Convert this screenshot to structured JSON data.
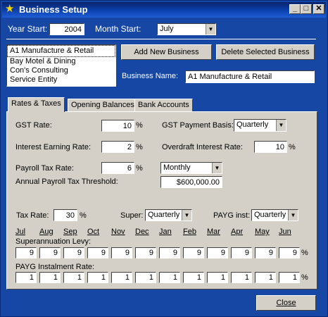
{
  "window": {
    "title": "Business Setup"
  },
  "header": {
    "year_start_label": "Year Start:",
    "year_start_value": "2004",
    "month_start_label": "Month Start:",
    "month_start_value": "July"
  },
  "businesses": {
    "items": [
      "A1 Manufacture & Retail",
      "Bay Motel & Dining",
      "Con's Consulting",
      "Service Entity"
    ],
    "selected_index": 0,
    "add_button": "Add New Business",
    "delete_button": "Delete Selected Business",
    "name_label": "Business Name:",
    "name_value": "A1 Manufacture & Retail"
  },
  "tabs": [
    "Rates & Taxes",
    "Opening Balances",
    "Bank Accounts"
  ],
  "rates": {
    "gst_rate_label": "GST Rate:",
    "gst_rate_value": "10",
    "gst_basis_label": "GST Payment Basis:",
    "gst_basis_value": "Quarterly",
    "interest_earning_label": "Interest Earning Rate:",
    "interest_earning_value": "2",
    "overdraft_label": "Overdraft Interest Rate:",
    "overdraft_value": "10",
    "payroll_tax_label": "Payroll Tax Rate:",
    "payroll_tax_value": "6",
    "payroll_freq_value": "Monthly",
    "threshold_label": "Annual Payroll Tax Threshold:",
    "threshold_value": "$600,000.00",
    "tax_rate_label": "Tax Rate:",
    "tax_rate_value": "30",
    "super_label": "Super:",
    "super_value": "Quarterly",
    "payg_label": "PAYG inst:",
    "payg_value": "Quarterly",
    "percent": "%"
  },
  "months": [
    "Jul",
    "Aug",
    "Sep",
    "Oct",
    "Nov",
    "Dec",
    "Jan",
    "Feb",
    "Mar",
    "Apr",
    "May",
    "Jun"
  ],
  "super_levy": {
    "label": "Superannuation Levy:",
    "values": [
      "9",
      "9",
      "9",
      "9",
      "9",
      "9",
      "9",
      "9",
      "9",
      "9",
      "9",
      "9"
    ]
  },
  "payg_instalment": {
    "label": "PAYG Instalment Rate:",
    "values": [
      "1",
      "1",
      "1",
      "1",
      "1",
      "1",
      "1",
      "1",
      "1",
      "1",
      "1",
      "1"
    ]
  },
  "close_button": "Close"
}
